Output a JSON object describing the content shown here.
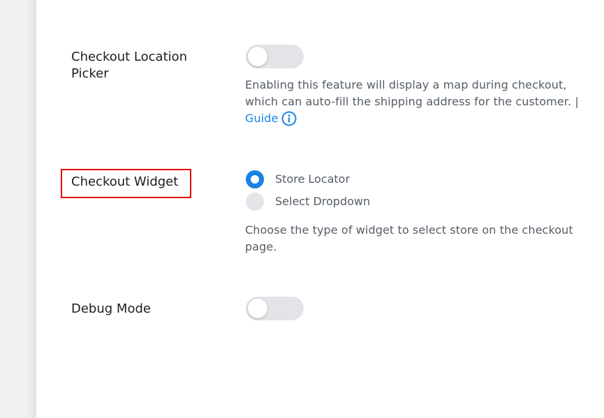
{
  "settings": {
    "checkout_location_picker": {
      "label": "Checkout Location Picker",
      "enabled": false,
      "description": "Enabling this feature will display a map during checkout, which can auto-fill the shipping address for the customer. |",
      "guide_label": "Guide",
      "guide_icon": "info-icon"
    },
    "checkout_widget": {
      "label": "Checkout Widget",
      "options": [
        {
          "label": "Store Locator",
          "selected": true
        },
        {
          "label": "Select Dropdown",
          "selected": false
        }
      ],
      "description": "Choose the type of widget to select store on the checkout page."
    },
    "debug_mode": {
      "label": "Debug Mode",
      "enabled": false
    }
  },
  "colors": {
    "accent": "#1a82e2",
    "highlight": "#e10000",
    "toggle_off": "#e2e4e7"
  }
}
